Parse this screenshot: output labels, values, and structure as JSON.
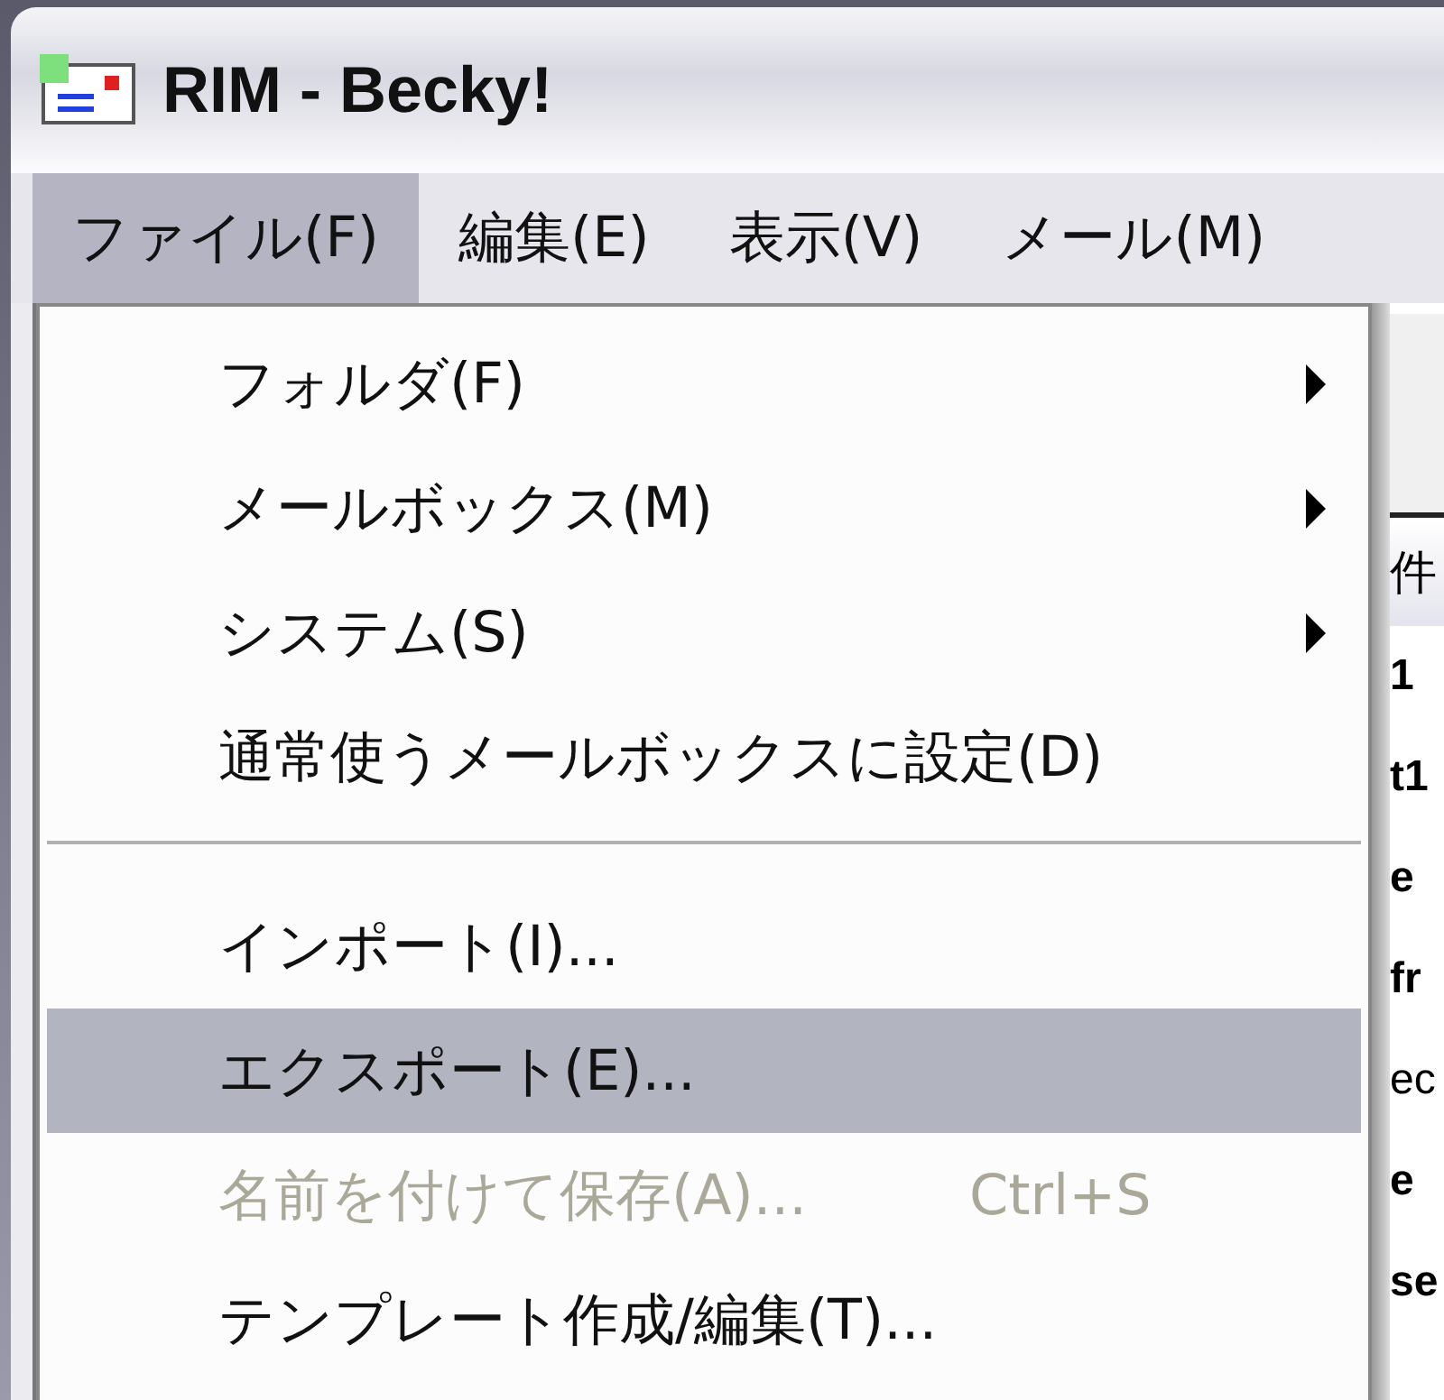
{
  "window": {
    "title": "RIM - Becky!"
  },
  "menubar": [
    {
      "label": "ファイル(F)",
      "selected": true
    },
    {
      "label": "編集(E)",
      "selected": false
    },
    {
      "label": "表示(V)",
      "selected": false
    },
    {
      "label": "メール(M)",
      "selected": false
    }
  ],
  "menu": [
    {
      "kind": "submenu",
      "label": "フォルダ(F)",
      "selected": false,
      "disabled": false
    },
    {
      "kind": "submenu",
      "label": "メールボックス(M)",
      "selected": false,
      "disabled": false
    },
    {
      "kind": "submenu",
      "label": "システム(S)",
      "selected": false,
      "disabled": false
    },
    {
      "kind": "command",
      "label": "通常使うメールボックスに設定(D)",
      "selected": false,
      "disabled": false
    },
    {
      "kind": "separator"
    },
    {
      "kind": "command",
      "label": "インポート(I)...",
      "selected": false,
      "disabled": false
    },
    {
      "kind": "command",
      "label": "エクスポート(E)...",
      "selected": true,
      "disabled": false
    },
    {
      "kind": "command",
      "label": "名前を付けて保存(A)...",
      "shortcut": "Ctrl+S",
      "selected": false,
      "disabled": true
    },
    {
      "kind": "command",
      "label": "テンプレート作成/編集(T)...",
      "selected": false,
      "disabled": false
    }
  ],
  "background_list": {
    "column_1": "件",
    "rows": [
      {
        "text": "1",
        "bold": true
      },
      {
        "text": "t1",
        "bold": true
      },
      {
        "text": "e",
        "bold": true
      },
      {
        "text": "fr",
        "bold": true
      },
      {
        "text": "ec",
        "bold": false
      },
      {
        "text": "e",
        "bold": true
      },
      {
        "text": "se",
        "bold": true
      }
    ]
  }
}
